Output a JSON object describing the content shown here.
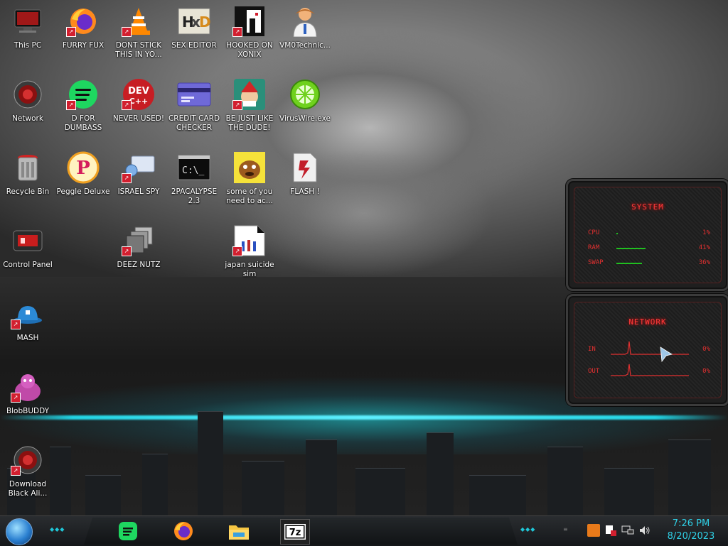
{
  "desktop": {
    "icons": [
      {
        "label": "This PC"
      },
      {
        "label": "FURRY FUX"
      },
      {
        "label": "DONT STICK THIS IN YO..."
      },
      {
        "label": "SEX EDITOR"
      },
      {
        "label": "HOOKED ON XONIX"
      },
      {
        "label": "VM0Technic..."
      },
      {
        "label": "Network"
      },
      {
        "label": "D FOR DUMBASS"
      },
      {
        "label": "NEVER USED!"
      },
      {
        "label": "CREDIT CARD CHECKER"
      },
      {
        "label": "BE JUST LIKE THE DUDE!"
      },
      {
        "label": "VirusWire.exe"
      },
      {
        "label": "Recycle Bin"
      },
      {
        "label": "Peggle Deluxe"
      },
      {
        "label": "ISRAEL SPY"
      },
      {
        "label": "2PACALYPSE 2.3"
      },
      {
        "label": "some of you need to ac..."
      },
      {
        "label": "FLASH !"
      },
      {
        "label": "Control Panel"
      },
      {
        "label": "DEEZ NUTZ"
      },
      {
        "label": "japan suicide sim"
      },
      {
        "label": "MASH"
      },
      {
        "label": "BlobBUDDY"
      },
      {
        "label": "Download Black Ali..."
      }
    ],
    "icon_glyphs": {
      "devcpp": "DEV C++",
      "cmd": "C:\\_",
      "sevenzip": "7z",
      "peggle": "P"
    }
  },
  "widgets": {
    "system": {
      "title": "SYSTEM",
      "rows": [
        {
          "label": "CPU",
          "value": "1%",
          "level": 0.01
        },
        {
          "label": "RAM",
          "value": "41%",
          "level": 0.41
        },
        {
          "label": "SWAP",
          "value": "36%",
          "level": 0.36
        }
      ]
    },
    "network": {
      "title": "NETWORK",
      "rows": [
        {
          "label": "IN",
          "value": "0%"
        },
        {
          "label": "OUT",
          "value": "0%"
        }
      ]
    }
  },
  "taskbar": {
    "pinned": [
      "spotify-icon",
      "firefox-icon",
      "file-explorer-icon",
      "7zip-icon"
    ],
    "tray_icons": [
      "network-status-icon",
      "flag-icon",
      "monitor-icon",
      "volume-icon",
      "updater-icon"
    ],
    "clock": {
      "time": "7:26 PM",
      "date": "8/20/2023"
    }
  },
  "colors": {
    "widget_accent": "#e23030",
    "taskbar_accent": "#2fd0e6",
    "shortcut_badge": "#d21f2f"
  }
}
